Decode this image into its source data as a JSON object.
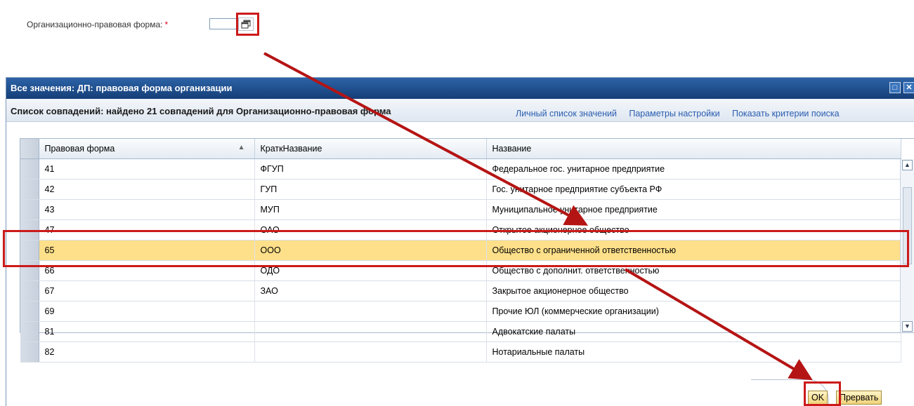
{
  "field": {
    "label": "Организационно-правовая форма:",
    "required_mark": "*",
    "value": ""
  },
  "dialog": {
    "title": "Все значения: ДП: правовая форма организации",
    "subtitle": "Список совпадений: найдено 21 совпадений для Организационно-правовая форма",
    "links": [
      "Личный список значений",
      "Параметры настройки",
      "Показать критерии поиска"
    ],
    "columns": [
      "Правовая форма",
      "КраткНазвание",
      "Название"
    ],
    "rows": [
      {
        "code": "41",
        "short": "ФГУП",
        "name": "Федеральное гос. унитарное предприятие"
      },
      {
        "code": "42",
        "short": "ГУП",
        "name": "Гос. унитарное предприятие субъекта РФ"
      },
      {
        "code": "43",
        "short": "МУП",
        "name": "Муниципальное унитарное предприятие"
      },
      {
        "code": "47",
        "short": "ОАО",
        "name": "Открытое акционерное общество"
      },
      {
        "code": "65",
        "short": "ООО",
        "name": "Общество с ограниченной ответственностью"
      },
      {
        "code": "66",
        "short": "ОДО",
        "name": "Общество с дополнит. ответственностью"
      },
      {
        "code": "67",
        "short": "ЗАО",
        "name": "Закрытое акционерное общество"
      },
      {
        "code": "69",
        "short": "",
        "name": "Прочие ЮЛ (коммерческие организации)"
      },
      {
        "code": "81",
        "short": "",
        "name": "Адвокатские палаты"
      },
      {
        "code": "82",
        "short": "",
        "name": "Нотариальные палаты"
      }
    ],
    "selected_row": 4,
    "ok_label": "OK",
    "cancel_label": "Прервать"
  },
  "colors": {
    "title_bar": "#1d4a8a",
    "selected_row": "#ffe08a",
    "highlight": "#cc1a1a",
    "link": "#2a5db0"
  }
}
